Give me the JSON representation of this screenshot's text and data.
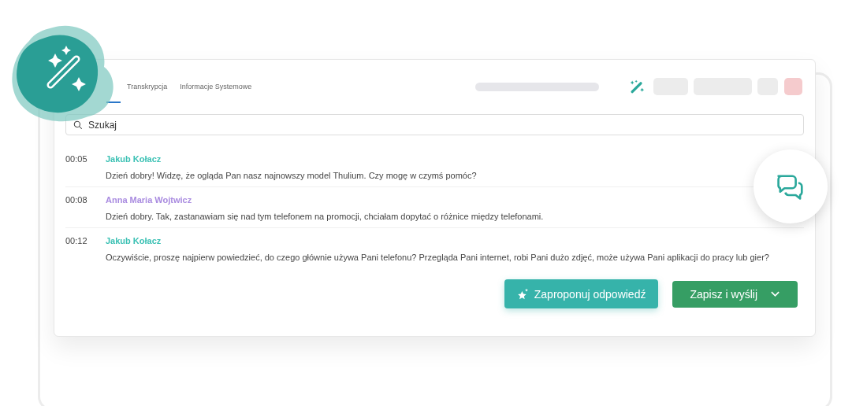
{
  "tabs": [
    {
      "label": "Transkrypcja",
      "selected": false
    },
    {
      "label": "Informacje Systemowe",
      "selected": false
    }
  ],
  "search": {
    "placeholder": "Szukaj"
  },
  "messages": [
    {
      "time": "00:05",
      "speaker": "Jakub Kołacz",
      "color": "#3cc1b4",
      "text": "Dzień dobry! Widzę, że ogląda Pan nasz najnowszy model Thulium. Czy mogę w czymś pomóc?"
    },
    {
      "time": "00:08",
      "speaker": "Anna Maria Wojtwicz",
      "color": "#a98be0",
      "text": "Dzień dobry. Tak, zastanawiam się nad tym telefonem na promocji, chciałam dopytać o różnice między telefonami."
    },
    {
      "time": "00:12",
      "speaker": "Jakub Kołacz",
      "color": "#3cc1b4",
      "text": "Oczywiście, proszę najpierw powiedzieć, do czego głównie używa Pani telefonu? Przegląda Pani internet, robi Pani dużo zdjęć, może używa Pani aplikacji do pracy lub gier?"
    }
  ],
  "buttons": {
    "suggest": "Zaproponuj odpowiedź",
    "save": "Zapisz i wyślij"
  }
}
